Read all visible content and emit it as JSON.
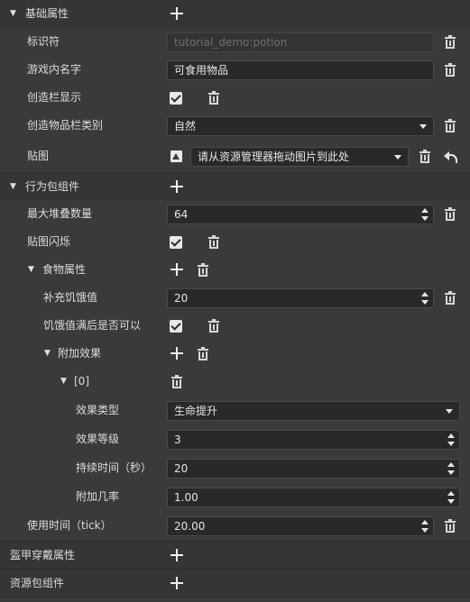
{
  "sections": {
    "basic": {
      "title": "基础属性"
    },
    "behavior": {
      "title": "行为包组件"
    },
    "armor": {
      "title": "盔甲穿戴属性"
    },
    "resource": {
      "title": "资源包组件"
    }
  },
  "basic": {
    "identifier": {
      "label": "标识符",
      "value": "tutorial_demo:potion"
    },
    "display_name": {
      "label": "游戏内名字",
      "value": "可食用物品"
    },
    "creative_show": {
      "label": "创造栏显示",
      "checked": true
    },
    "creative_category": {
      "label": "创造物品栏类别",
      "value": "自然"
    },
    "texture": {
      "label": "贴图",
      "value": "请从资源管理器拖动图片到此处"
    }
  },
  "behavior": {
    "max_stack": {
      "label": "最大堆叠数量",
      "value": "64"
    },
    "texture_flash": {
      "label": "贴图闪烁",
      "checked": true
    },
    "food": {
      "title": "食物属性",
      "nutrition": {
        "label": "补充饥饿值",
        "value": "20"
      },
      "can_always_eat": {
        "label": "饥饿值满后是否可以",
        "checked": true
      },
      "effects": {
        "title": "附加效果",
        "item0": {
          "title": "[0]",
          "effect_type": {
            "label": "效果类型",
            "value": "生命提升"
          },
          "effect_level": {
            "label": "效果等级",
            "value": "3"
          },
          "duration": {
            "label": "持续时间（秒）",
            "value": "20"
          },
          "chance": {
            "label": "附加几率",
            "value": "1.00"
          }
        }
      }
    },
    "use_time": {
      "label": "使用时间（tick）",
      "value": "20.00"
    }
  },
  "icons": {
    "expand": "caret-down-icon",
    "add": "plus-icon",
    "delete": "trash-icon",
    "check": "checkbox-checked-icon",
    "image": "image-icon",
    "reset": "undo-icon"
  }
}
